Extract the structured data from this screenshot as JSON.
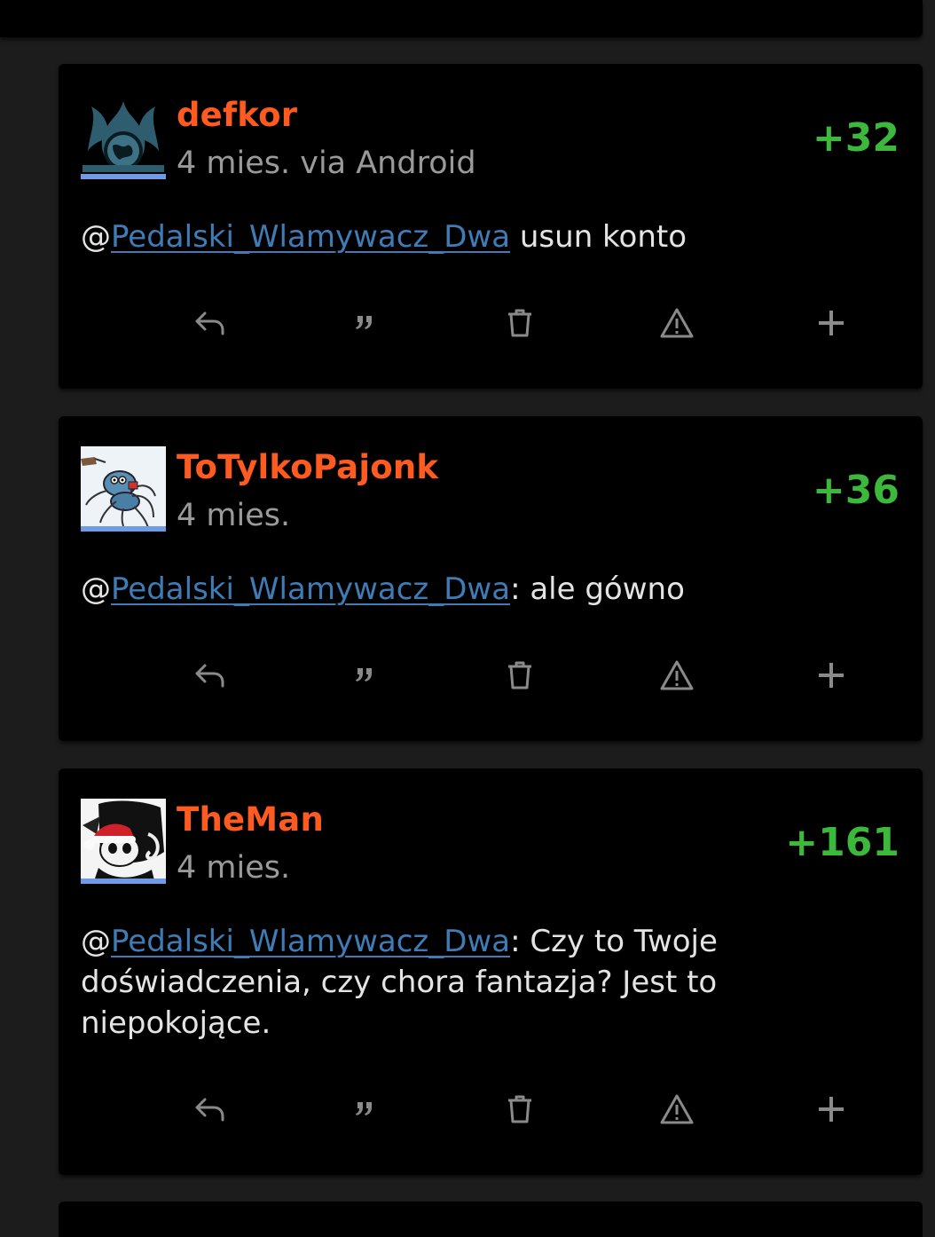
{
  "comments": [
    {
      "username": "defkor",
      "meta": "4 mies. via Android",
      "score": "+32",
      "mention": "Pedalski_Wlamywacz_Dwa",
      "text": " usun konto"
    },
    {
      "username": "ToTylkoPajonk",
      "meta": "4 mies.",
      "score": "+36",
      "mention": "Pedalski_Wlamywacz_Dwa",
      "text": ": ale gówno"
    },
    {
      "username": "TheMan",
      "meta": "4 mies.",
      "score": "+161",
      "mention": "Pedalski_Wlamywacz_Dwa",
      "text": ": Czy to Twoje doświadczenia, czy chora fantazja? Jest to niepokojące."
    }
  ],
  "mention_prefix": "@",
  "action_icons": [
    "reply-icon",
    "quote-icon",
    "trash-icon",
    "warning-icon",
    "plus-icon"
  ],
  "colors": {
    "username": "#ff5a1f",
    "score": "#3cb93a",
    "mention": "#3f7cb6",
    "avatar_bar": "#6f9be6",
    "card": "#000000",
    "page": "#1c1c1c"
  }
}
